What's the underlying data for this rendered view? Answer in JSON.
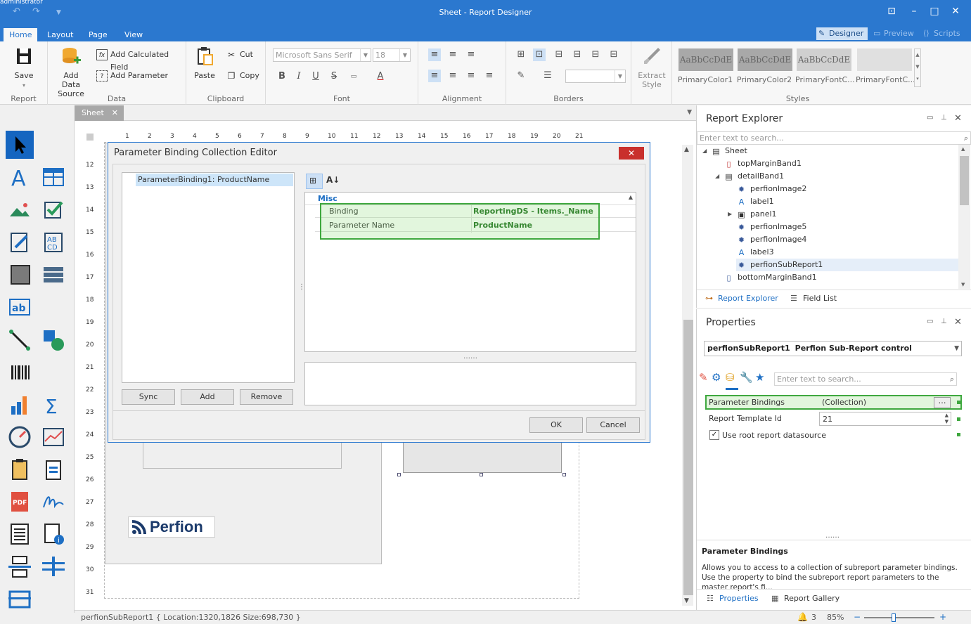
{
  "window": {
    "title": "Sheet - Report Designer",
    "corner_text": "administrator"
  },
  "tabs": {
    "home": "Home",
    "layout": "Layout",
    "page": "Page",
    "view": "View",
    "designer": "Designer",
    "preview": "Preview",
    "scripts": "Scripts"
  },
  "ribbon": {
    "report": {
      "save": "Save",
      "group": "Report"
    },
    "data": {
      "add_data_source_1": "Add Data",
      "add_data_source_2": "Source",
      "add_calculated_field": "Add Calculated Field",
      "add_parameter": "Add Parameter",
      "group": "Data"
    },
    "clipboard": {
      "paste": "Paste",
      "cut": "Cut",
      "copy": "Copy",
      "group": "Clipboard"
    },
    "font": {
      "family": "Microsoft Sans Serif",
      "size": "18",
      "group": "Font"
    },
    "alignment": {
      "group": "Alignment"
    },
    "borders": {
      "group": "Borders"
    },
    "extract_style_1": "Extract",
    "extract_style_2": "Style",
    "styles": {
      "sample": "AaBbCcDdE",
      "items": [
        "PrimaryColor1",
        "PrimaryColor2",
        "PrimaryFontC...",
        "PrimaryFontC..."
      ],
      "group": "Styles"
    }
  },
  "document": {
    "tab": "Sheet"
  },
  "ruler_h": [
    "1",
    "2",
    "3",
    "4",
    "5",
    "6",
    "7",
    "8",
    "9",
    "10",
    "11",
    "12",
    "13",
    "14",
    "15",
    "16",
    "17",
    "18",
    "19",
    "20",
    "21"
  ],
  "ruler_v": [
    "12",
    "13",
    "14",
    "15",
    "16",
    "17",
    "18",
    "19",
    "20",
    "21",
    "22",
    "23",
    "24",
    "25",
    "26",
    "27",
    "28",
    "29",
    "30",
    "31"
  ],
  "logo": {
    "text": "Perfion"
  },
  "dialog": {
    "title": "Parameter Binding Collection Editor",
    "list_item": "ParameterBinding1: ProductName",
    "sync": "Sync",
    "add": "Add",
    "remove": "Remove",
    "category": "Misc",
    "rows": [
      {
        "name": "Binding",
        "value": "ReportingDS - Items._Name"
      },
      {
        "name": "Parameter Name",
        "value": "ProductName"
      }
    ],
    "ok": "OK",
    "cancel": "Cancel"
  },
  "explorer": {
    "title": "Report Explorer",
    "search_placeholder": "Enter text to search...",
    "nodes": [
      "Sheet",
      "topMarginBand1",
      "detailBand1",
      "perfionImage2",
      "label1",
      "panel1",
      "perfionImage5",
      "perfionImage4",
      "label3",
      "perfionSubReport1",
      "bottomMarginBand1"
    ],
    "tab_explorer": "Report Explorer",
    "tab_fieldlist": "Field List"
  },
  "properties": {
    "title": "Properties",
    "selector_name": "perfionSubReport1",
    "selector_type": "Perfion Sub-Report control",
    "search_placeholder": "Enter text to search...",
    "rows": [
      {
        "name": "Parameter Bindings",
        "value": "(Collection)"
      },
      {
        "name": "Report Template Id",
        "value": "21"
      }
    ],
    "use_root": "Use root report datasource",
    "desc_title": "Parameter Bindings",
    "desc_text": "Allows you to access to a collection of subreport parameter bindings. Use the property to bind the subreport report parameters to the master report's fi...",
    "tab_properties": "Properties",
    "tab_gallery": "Report Gallery"
  },
  "status": {
    "text": "perfionSubReport1 { Location:1320,1826 Size:698,730 }",
    "count": "3",
    "zoom": "85%"
  },
  "colors": {
    "accent": "#2b78cf",
    "highlight_green": "#3fa83f",
    "close_red": "#c9302c"
  }
}
